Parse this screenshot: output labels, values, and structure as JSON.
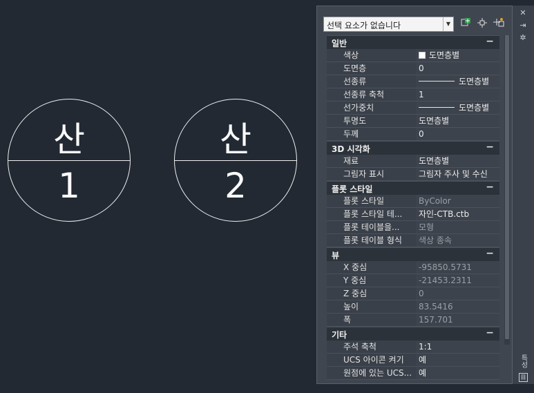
{
  "drawing": {
    "bubbles": [
      {
        "top": "산",
        "bottom": "1"
      },
      {
        "top": "산",
        "bottom": "2"
      }
    ]
  },
  "palette": {
    "selection_label": "선택 요소가 없습니다",
    "icons": [
      "quick-select-icon",
      "select-objects-icon",
      "pickadd-toggle-icon"
    ],
    "rail_icons": [
      "close-icon",
      "auto-hide-icon",
      "properties-menu-icon",
      "vertical-title-label",
      "palette-toggle-icon"
    ],
    "rail_title": "특성",
    "collapse_glyph": "−",
    "sections": [
      {
        "title": "일반",
        "rows": [
          {
            "key": "색상",
            "value": "도면층별",
            "swatch": true
          },
          {
            "key": "도면층",
            "value": "0"
          },
          {
            "key": "선종류",
            "value": "도면층별",
            "line": true
          },
          {
            "key": "선종류 축척",
            "value": "1"
          },
          {
            "key": "선가중치",
            "value": "도면층별",
            "line": true
          },
          {
            "key": "투명도",
            "value": "도면층별"
          },
          {
            "key": "두께",
            "value": "0"
          }
        ]
      },
      {
        "title": "3D 시각화",
        "rows": [
          {
            "key": "재료",
            "value": "도면층별"
          },
          {
            "key": "그림자 표시",
            "value": "그림자 주사 및 수신"
          }
        ]
      },
      {
        "title": "플롯 스타일",
        "rows": [
          {
            "key": "플롯 스타일",
            "value": "ByColor",
            "dim": true
          },
          {
            "key": "플롯 스타일 테...",
            "value": "자인-CTB.ctb"
          },
          {
            "key": "플롯 테이블을...",
            "value": "모형",
            "dim": true
          },
          {
            "key": "플롯 테이블 형식",
            "value": "색상 종속",
            "dim": true
          }
        ]
      },
      {
        "title": "뷰",
        "rows": [
          {
            "key": "X 중심",
            "value": "-95850.5731",
            "dim": true
          },
          {
            "key": "Y 중심",
            "value": "-21453.2311",
            "dim": true
          },
          {
            "key": "Z 중심",
            "value": "0",
            "dim": true
          },
          {
            "key": "높이",
            "value": "83.5416",
            "dim": true
          },
          {
            "key": "폭",
            "value": "157.701",
            "dim": true
          }
        ]
      },
      {
        "title": "기타",
        "rows": [
          {
            "key": "주석 축척",
            "value": "1:1"
          },
          {
            "key": "UCS 아이콘 켜기",
            "value": "예"
          },
          {
            "key": "원점에 있는 UCS...",
            "value": "예"
          }
        ]
      }
    ]
  }
}
